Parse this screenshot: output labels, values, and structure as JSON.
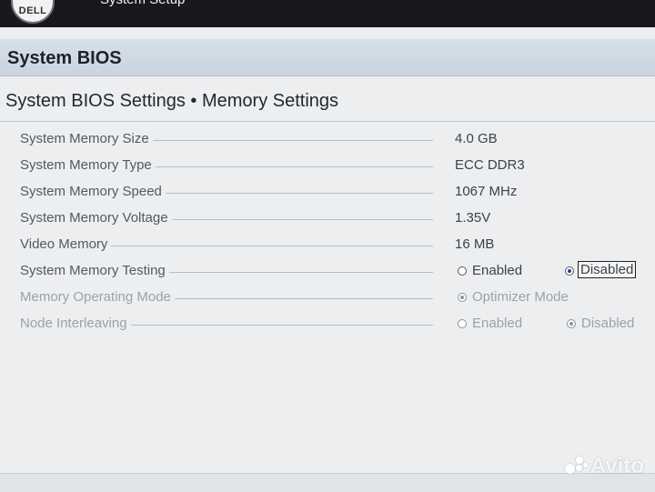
{
  "header": {
    "logo_text": "DELL",
    "app_title": "System Setup"
  },
  "page": {
    "section_title": "System BIOS",
    "subtitle": "System BIOS Settings • Memory Settings"
  },
  "settings": [
    {
      "label": "System Memory Size",
      "value": "4.0 GB"
    },
    {
      "label": "System Memory Type",
      "value": "ECC DDR3"
    },
    {
      "label": "System Memory Speed",
      "value": "1067 MHz"
    },
    {
      "label": "System Memory Voltage",
      "value": "1.35V"
    },
    {
      "label": "Video Memory",
      "value": "16 MB"
    },
    {
      "label": "System Memory Testing",
      "options": [
        "Enabled",
        "Disabled"
      ],
      "selected": "Disabled"
    },
    {
      "label": "Memory Operating Mode",
      "options": [
        "Optimizer Mode"
      ],
      "selected": "Optimizer Mode"
    },
    {
      "label": "Node Interleaving",
      "options": [
        "Enabled",
        "Disabled"
      ],
      "selected": "Disabled"
    }
  ],
  "watermark": "Avito",
  "colors": {
    "header_bg": "#17191c",
    "title_band": "#c9d4df",
    "radio_selected": "#2b3f9e",
    "disabled_text": "#9da2a7"
  }
}
